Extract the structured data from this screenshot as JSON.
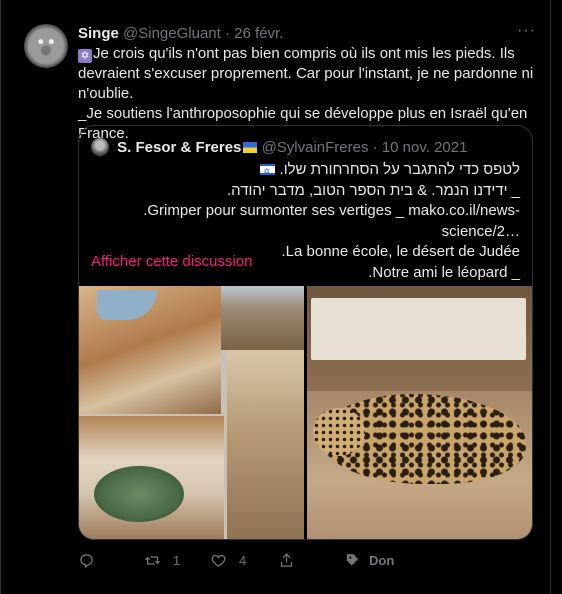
{
  "tweet": {
    "author_name": "Singe",
    "handle": "@SingeGluant",
    "separator": "·",
    "date": "26 févr.",
    "more": "···",
    "lines": [
      "Je crois qu'ils n'ont pas bien compris où ils ont mis les pieds. Ils devraient s'excuser proprement. Car pour l'instant, je ne pardonne ni n'oublie.",
      "_Je soutiens l'anthroposophie qui se développe plus en Israël qu'en France."
    ]
  },
  "quote": {
    "author_name": "S. Fesor & Freres",
    "handle": "@SylvainFreres",
    "separator": "·",
    "date": "10 nov. 2021",
    "lines": [
      "לטפס כדי להתגבר על הסחרחורת שלו.",
      "_ ידידנו הנמר. & בית הספר הטוב, מדבר יהודה.",
      ".Grimper pour surmonter ses vertiges _ mako.co.il/news-science/2…",
      ".La bonne école, le désert de Judée",
      ".Notre ami le léopard _"
    ],
    "show_thread": "Afficher cette discussion"
  },
  "actions": {
    "retweets": "1",
    "likes": "4",
    "donate": "Don"
  }
}
